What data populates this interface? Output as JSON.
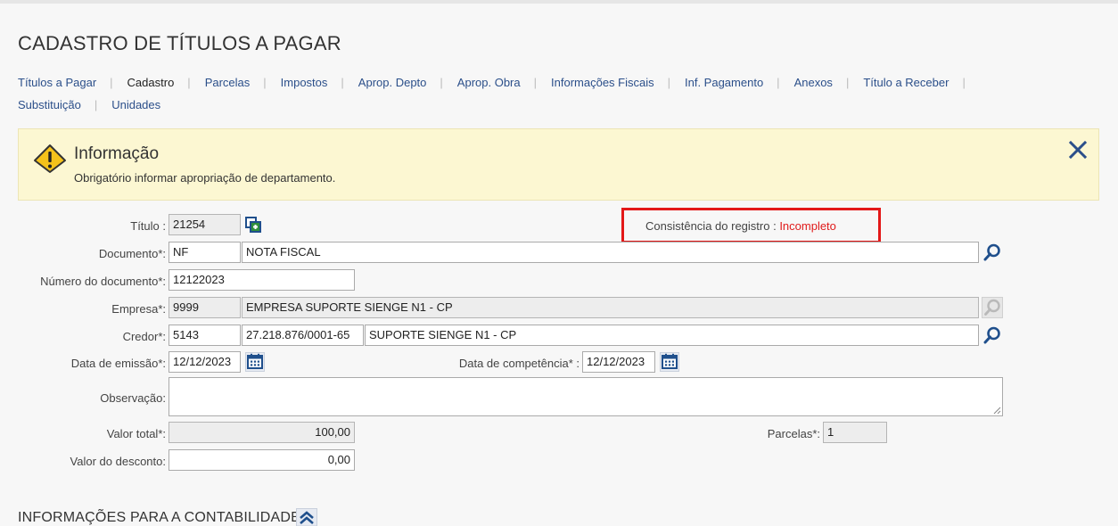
{
  "page_title": "CADASTRO DE TÍTULOS A PAGAR",
  "tabs": [
    {
      "label": "Títulos a Pagar"
    },
    {
      "label": "Cadastro"
    },
    {
      "label": "Parcelas"
    },
    {
      "label": "Impostos"
    },
    {
      "label": "Aprop. Depto"
    },
    {
      "label": "Aprop. Obra"
    },
    {
      "label": "Informações Fiscais"
    },
    {
      "label": "Inf. Pagamento"
    },
    {
      "label": "Anexos"
    },
    {
      "label": "Título a Receber"
    },
    {
      "label": "Substituição"
    },
    {
      "label": "Unidades"
    }
  ],
  "alert": {
    "title": "Informação",
    "message": "Obrigatório informar apropriação de departamento."
  },
  "consistency": {
    "label": "Consistência do registro :",
    "value": "Incompleto"
  },
  "form": {
    "titulo": {
      "label": "Título :",
      "value": "21254"
    },
    "documento": {
      "label": "Documento*:",
      "code": "NF",
      "description": "NOTA FISCAL"
    },
    "numero_documento": {
      "label": "Número do documento*:",
      "value": "12122023"
    },
    "empresa": {
      "label": "Empresa*:",
      "code": "9999",
      "name": "EMPRESA SUPORTE SIENGE N1 - CP"
    },
    "credor": {
      "label": "Credor*:",
      "code": "5143",
      "cnpj": "27.218.876/0001-65",
      "name": "SUPORTE SIENGE N1 - CP"
    },
    "data_emissao": {
      "label": "Data de emissão*:",
      "value": "12/12/2023"
    },
    "data_competencia": {
      "label": "Data de competência* :",
      "value": "12/12/2023"
    },
    "observacao": {
      "label": "Observação:",
      "value": ""
    },
    "valor_total": {
      "label": "Valor total*:",
      "value": "100,00"
    },
    "parcelas": {
      "label": "Parcelas*:",
      "value": "1"
    },
    "valor_desconto": {
      "label": "Valor do desconto:",
      "value": "0,00"
    }
  },
  "section": {
    "title": "INFORMAÇÕES PARA A CONTABILIDADE"
  },
  "colors": {
    "accent": "#2b4f8a",
    "alert_bg": "#fcf7d2",
    "highlight_border": "#e31818",
    "error_text": "#e01b1b"
  }
}
